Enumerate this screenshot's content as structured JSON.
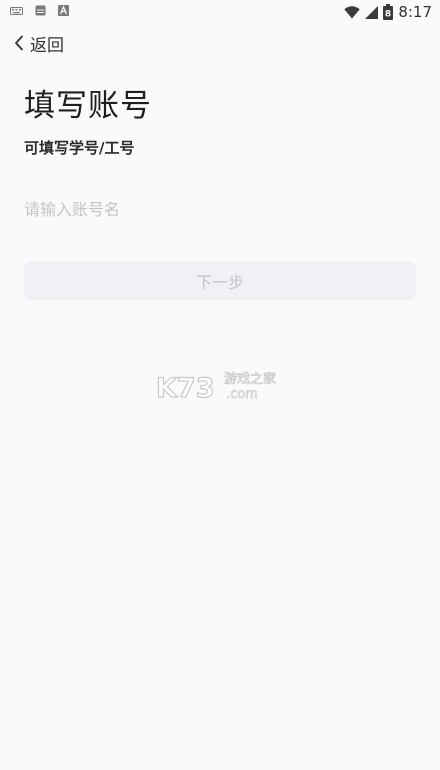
{
  "status_bar": {
    "time": "8:17",
    "battery_level": "8",
    "left_icons": [
      "keyboard-icon",
      "storage-icon",
      "font-icon"
    ],
    "right_icons": [
      "wifi-icon",
      "cell-signal-icon",
      "battery-icon"
    ]
  },
  "nav": {
    "back_label": "返回"
  },
  "page": {
    "title": "填写账号",
    "subtitle": "可填写学号/工号"
  },
  "form": {
    "account_placeholder": "请输入账号名",
    "account_value": "",
    "next_label": "下一步"
  },
  "watermark": {
    "brand": "K73",
    "tagline": "游戏之家",
    "domain": ".com"
  },
  "colors": {
    "background": "#fafafa",
    "button_bg": "#f0f1f4",
    "button_text": "#c2c3c8",
    "placeholder": "#c4c4c8"
  }
}
